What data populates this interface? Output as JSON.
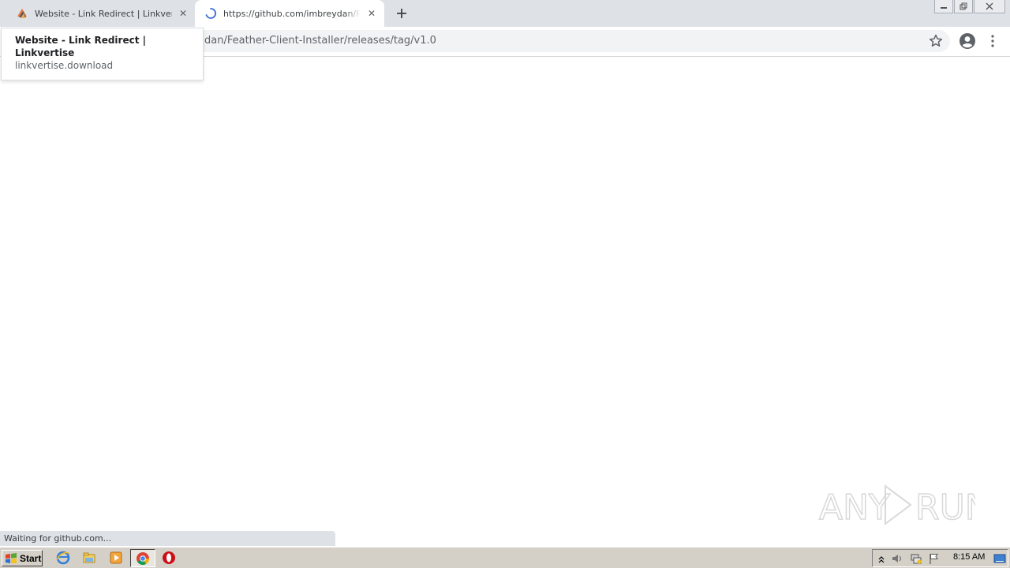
{
  "browser": {
    "tabs": [
      {
        "title": "Website - Link Redirect | Linkvertise",
        "favicon": "linkvertise-icon",
        "active": false
      },
      {
        "title": "https://github.com/imbreydan/Feath",
        "favicon": "loading-spinner-icon",
        "active": true
      }
    ],
    "url_visible": "dan/Feather-Client-Installer/releases/tag/v1.0"
  },
  "hovercard": {
    "title": "Website - Link Redirect  |  Linkvertise",
    "domain": "linkvertise.download"
  },
  "status_text": "Waiting for github.com...",
  "watermark": {
    "text": "ANY RUN"
  },
  "taskbar": {
    "start_label": "Start",
    "clock": "8:15 AM",
    "quicklaunch": [
      "ie-icon",
      "explorer-icon",
      "media-player-icon",
      "chrome-icon",
      "opera-icon"
    ]
  },
  "colors": {
    "tabstrip": "#dee1e6",
    "omnibox": "#f1f3f4",
    "taskbar": "#d4d0c8"
  }
}
